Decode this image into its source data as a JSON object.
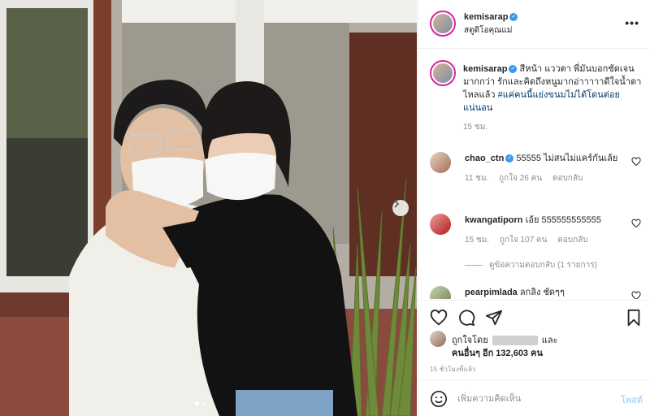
{
  "header": {
    "username": "kemisarap",
    "verified_icon": "verified-badge-icon",
    "subtitle": "สตูดิโอคุณแม่",
    "more_label": "•••"
  },
  "caption": {
    "username": "kemisarap",
    "text": "สีหน้า แววตา พี่มันบอกชัดเจนมากกว่า รักและคิดถึงหนูมากอ่าาาาาดีใจน้ำตาไหลแล้ว ",
    "hashtag": "#แค่คนนี้แย่งขนมไม่ได้โดนต่อยแน่นอน",
    "time": "15 ชม."
  },
  "comments": [
    {
      "username": "chao_ctn",
      "verified": true,
      "text": "55555 ไม่สนไม่แคร์กันเล้ย",
      "time": "11 ชม.",
      "likes": "ถูกใจ 26 คน",
      "reply": "ตอบกลับ"
    },
    {
      "username": "kwangatiporn",
      "verified": false,
      "text": "เอ้ย 555555555555",
      "time": "15 ชม.",
      "likes": "ถูกใจ 107 คน",
      "reply": "ตอบกลับ"
    },
    {
      "username": "pearpimlada",
      "verified": false,
      "text": "ลกลิง ชัดๆๆ",
      "time": "",
      "likes": "",
      "reply": ""
    }
  ],
  "view_replies": "ดูข้อความตอบกลับ (1 รายการ)",
  "likes": {
    "prefix": "ถูกใจโดย",
    "suffix": "และ",
    "others": "คนอื่นๆ อีก 132,603 คน"
  },
  "post_time": "15 ชั่วโมงที่แล้ว",
  "comment_box": {
    "placeholder": "เพิ่มความคิดเห็น",
    "post_label": "โพสต์"
  },
  "colors": {
    "link": "#00376b",
    "verified": "#3897f0",
    "post_disabled": "#b3dbff",
    "muted": "#8e8e8e"
  }
}
